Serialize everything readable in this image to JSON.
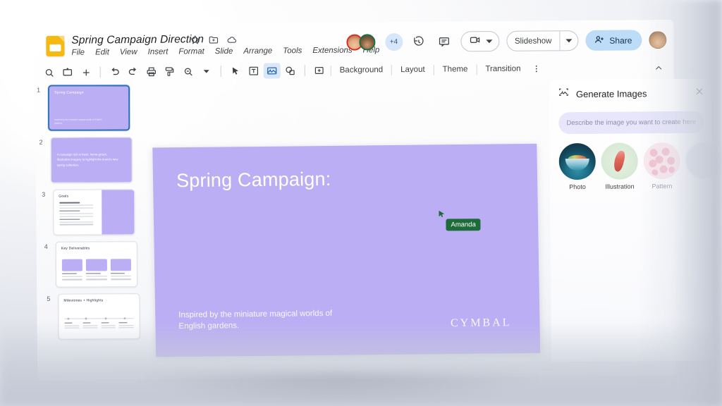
{
  "app": {
    "name": "Google Slides",
    "logo_icon": "slides-logo-icon",
    "doc_title": "Spring Campaign Direction",
    "title_icons": [
      "star-icon",
      "move-to-folder-icon",
      "cloud-saved-icon"
    ],
    "menu": [
      "File",
      "Edit",
      "View",
      "Insert",
      "Format",
      "Slide",
      "Arrange",
      "Tools",
      "Extensions",
      "Help"
    ]
  },
  "header_right": {
    "collaborator_overflow": "+4",
    "history_icon": "version-history-icon",
    "comment_icon": "comment-icon",
    "meet_icon": "video-camera-icon",
    "meet_caret_icon": "chevron-down-icon",
    "slideshow_label": "Slideshow",
    "slideshow_caret_icon": "chevron-down-icon",
    "share_label": "Share",
    "share_icon": "person-add-icon",
    "share_bg": "#bcdcf7",
    "profile_avatar": "account-avatar"
  },
  "toolbar": {
    "icons": [
      "search-icon",
      "new-slide-icon",
      "plus-icon",
      "undo-icon",
      "redo-icon",
      "print-icon",
      "paint-format-icon",
      "zoom-icon",
      "zoom-caret-icon",
      "select-cursor-icon",
      "text-box-icon",
      "insert-image-icon",
      "shape-icon",
      "line-icon"
    ],
    "buttons": [
      "Background",
      "Layout",
      "Theme",
      "Transition"
    ],
    "overflow_icon": "more-vertical-icon",
    "collapse_icon": "chevron-up-icon",
    "active_tool": "insert-image-icon"
  },
  "filmstrip": {
    "slides": [
      {
        "number": "1",
        "title": "Spring Campaign",
        "subtitle": "Inspired by the miniature magical worlds of English gardens.",
        "selected": true
      },
      {
        "number": "2",
        "body": "A campaign rich in fresh, home-grown, illustrative imagery to highlight the brand's new spring collection.",
        "selected": false
      },
      {
        "number": "3",
        "title": "Goals",
        "selected": false
      },
      {
        "number": "4",
        "title": "Key Deliverables",
        "selected": false
      },
      {
        "number": "5",
        "title": "Milestones + Highlights",
        "selected": false
      }
    ]
  },
  "slide": {
    "title": "Spring Campaign:",
    "footer": "Inspired by the miniature magical worlds of English gardens.",
    "logo": "CYMBAL",
    "background_color": "#bbaef5",
    "text_color": "#ffffff"
  },
  "collaborator_cursor": {
    "name": "Amanda",
    "color": "#1e6b3a",
    "cursor_icon": "pointer-cursor-icon"
  },
  "generate_images_panel": {
    "title": "Generate Images",
    "panel_icon": "generate-image-icon",
    "close_icon": "close-icon",
    "prompt_placeholder": "Describe the image you want to create here",
    "prompt_value": "",
    "styles": [
      {
        "label": "Photo",
        "swatch": "photo-style-swatch"
      },
      {
        "label": "Illustration",
        "swatch": "illustration-style-swatch"
      },
      {
        "label": "Pattern",
        "swatch": "pattern-style-swatch"
      },
      {
        "label": "",
        "swatch": "additional-style-swatch"
      }
    ]
  }
}
